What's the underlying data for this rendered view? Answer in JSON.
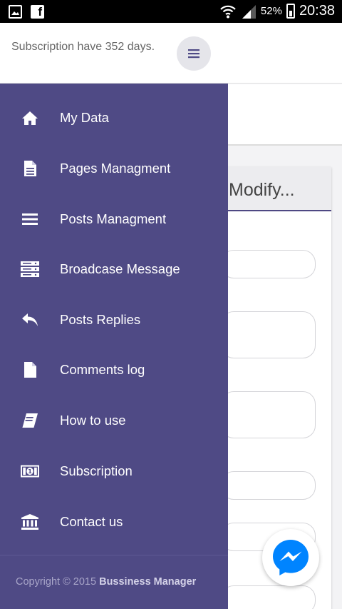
{
  "status_bar": {
    "battery": "52%",
    "time": "20:38",
    "icons": [
      "gallery-icon",
      "facebook-icon",
      "wifi-icon",
      "signal-icon",
      "battery-icon"
    ]
  },
  "header": {
    "subscription_text": "Subscription have 352 days.",
    "menu_icon": "hamburger-icon"
  },
  "background": {
    "card_title": "Modify..."
  },
  "drawer": {
    "background_color": "#4f4a85",
    "items": [
      {
        "label": "My Data",
        "icon": "home-icon"
      },
      {
        "label": "Pages Managment",
        "icon": "document-icon"
      },
      {
        "label": "Posts Managment",
        "icon": "list-icon"
      },
      {
        "label": "Broadcase Message",
        "icon": "server-icon"
      },
      {
        "label": "Posts Replies",
        "icon": "reply-icon"
      },
      {
        "label": "Comments log",
        "icon": "file-icon"
      },
      {
        "label": "How to use",
        "icon": "book-icon"
      },
      {
        "label": "Subscription",
        "icon": "money-icon"
      },
      {
        "label": "Contact us",
        "icon": "bank-icon"
      }
    ],
    "copyright_prefix": "Copyright © 2015",
    "copyright_brand": "Bussiness Manager"
  },
  "fab": {
    "icon": "messenger-icon",
    "color": "#0084ff"
  }
}
